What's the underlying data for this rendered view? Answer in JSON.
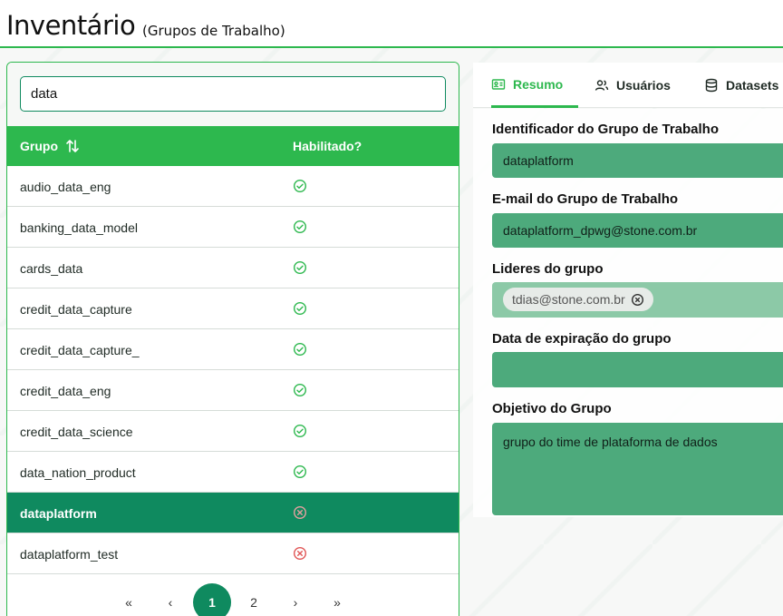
{
  "header": {
    "title": "Inventário",
    "subtitle": "(Grupos de Trabalho)"
  },
  "search": {
    "value": "data",
    "placeholder": ""
  },
  "table": {
    "columns": {
      "group": "Grupo",
      "enabled": "Habilitado?"
    },
    "rows": [
      {
        "name": "audio_data_eng",
        "enabled": true
      },
      {
        "name": "banking_data_model",
        "enabled": true
      },
      {
        "name": "cards_data",
        "enabled": true
      },
      {
        "name": "credit_data_capture",
        "enabled": true
      },
      {
        "name": "credit_data_capture_",
        "enabled": true
      },
      {
        "name": "credit_data_eng",
        "enabled": true
      },
      {
        "name": "credit_data_science",
        "enabled": true
      },
      {
        "name": "data_nation_product",
        "enabled": true
      },
      {
        "name": "dataplatform",
        "enabled": false,
        "selected": true
      },
      {
        "name": "dataplatform_test",
        "enabled": false
      }
    ]
  },
  "pagination": {
    "first": "«",
    "prev": "‹",
    "pages": [
      "1",
      "2"
    ],
    "current": "1",
    "next": "›",
    "last": "»"
  },
  "tabs": [
    {
      "label": "Resumo",
      "icon": "id-card-icon",
      "active": true
    },
    {
      "label": "Usuários",
      "icon": "users-icon",
      "active": false
    },
    {
      "label": "Datasets",
      "icon": "database-icon",
      "active": false
    }
  ],
  "form": {
    "id_label": "Identificador do Grupo de Trabalho",
    "id_value": "dataplatform",
    "email_label": "E-mail do Grupo de Trabalho",
    "email_value": "dataplatform_dpwg@stone.com.br",
    "leaders_label": "Lideres do grupo",
    "leaders": [
      "tdias@stone.com.br"
    ],
    "expiration_label": "Data de expiração do grupo",
    "expiration_value": "",
    "objective_label": "Objetivo do Grupo",
    "objective_value": "grupo do time de plataforma de dados"
  },
  "colors": {
    "accent": "#2db84e",
    "selected_row": "#0f8a5f",
    "field_bg": "#4daa7c",
    "enabled_icon": "#2db84e",
    "disabled_icon": "#e05555"
  }
}
